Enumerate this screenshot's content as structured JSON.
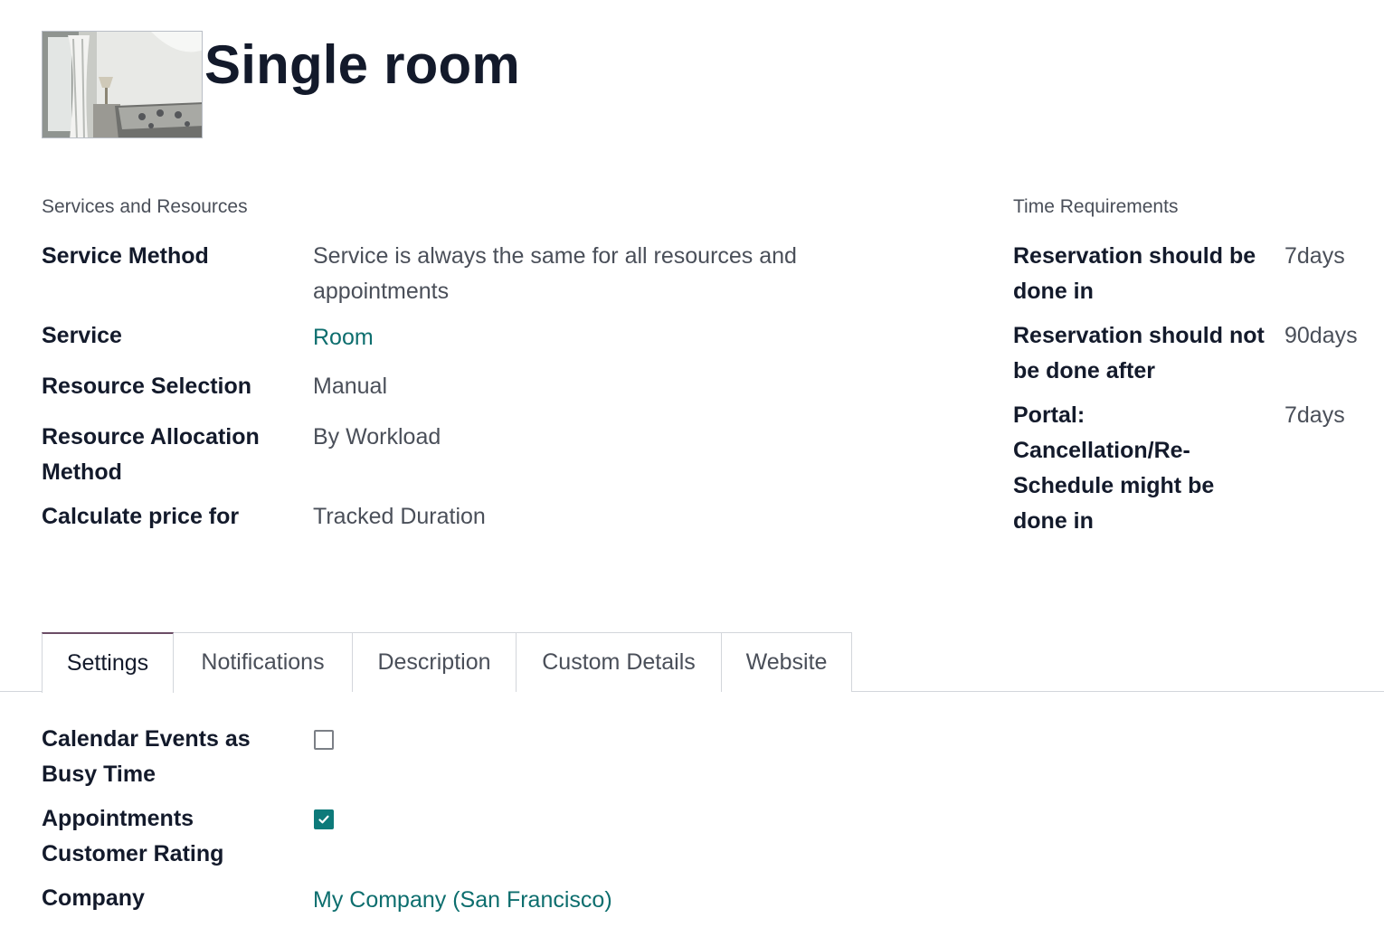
{
  "record": {
    "title": "Single room",
    "image_icon": "bedroom-photo"
  },
  "services": {
    "heading": "Services and Resources",
    "fields": [
      {
        "label": "Service Method",
        "value": "Service is always the same for all resources and appointments"
      },
      {
        "label": "Service",
        "value": "Room"
      },
      {
        "label": "Resource Selection",
        "value": "Manual"
      },
      {
        "label": "Resource Allocation Method",
        "value": "By Workload"
      },
      {
        "label": "Calculate price for",
        "value": "Tracked Duration"
      }
    ]
  },
  "time": {
    "heading": "Time Requirements",
    "fields": [
      {
        "label": "Reservation should be done in",
        "value": "7days"
      },
      {
        "label": "Reservation should not be done after",
        "value": "90days"
      },
      {
        "label": "Portal: Cancellation/Re-Schedule might be done in",
        "value": "7days"
      }
    ]
  },
  "tabs": [
    {
      "label": "Settings",
      "active": true
    },
    {
      "label": "Notifications",
      "active": false
    },
    {
      "label": "Description",
      "active": false
    },
    {
      "label": "Custom Details",
      "active": false
    },
    {
      "label": "Website",
      "active": false
    }
  ],
  "settings": {
    "fields": [
      {
        "label": "Calendar Events as Busy Time",
        "checked": false
      },
      {
        "label": "Appointments Customer Rating",
        "checked": true
      },
      {
        "label": "Company",
        "value": "My Company (San Francisco)"
      }
    ]
  },
  "colors": {
    "link": "#0d6e6e",
    "checkbox_checked": "#0d7a7a",
    "active_tab_accent": "#6b4d66"
  }
}
